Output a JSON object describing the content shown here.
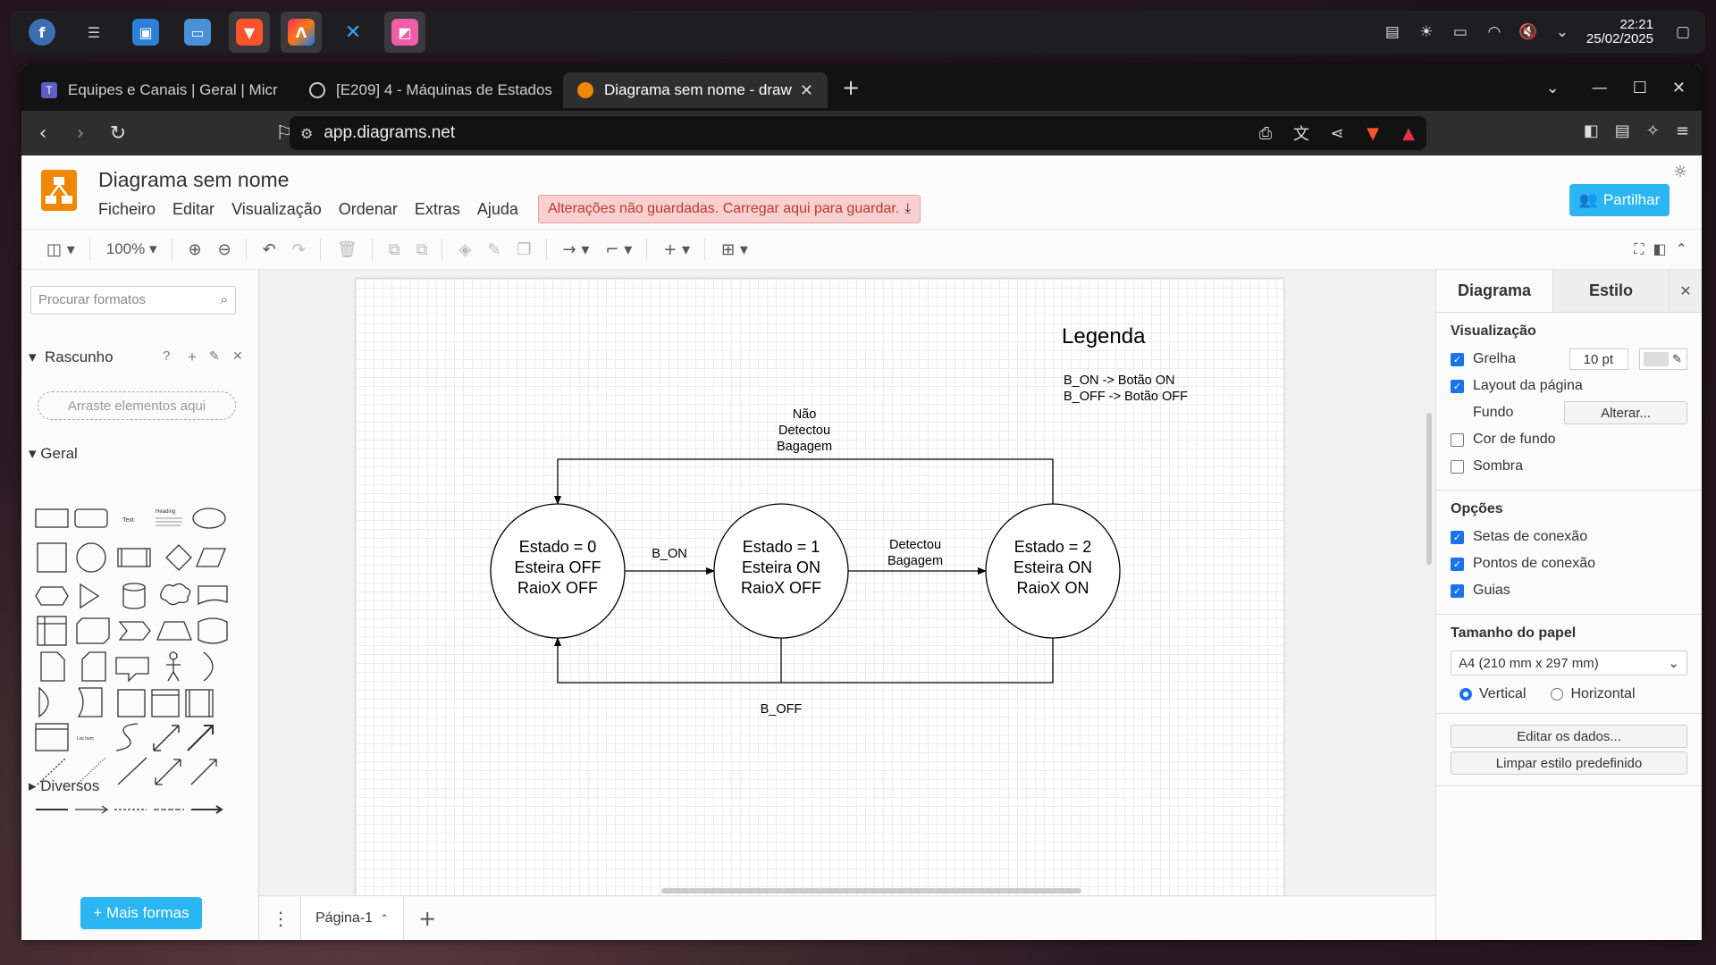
{
  "taskbar": {
    "apps": [
      "fedora-icon",
      "settings-app-icon",
      "software-store-icon",
      "file-manager-icon",
      "brave-browser-icon",
      "intellij-icon",
      "vscode-icon",
      "screenshot-app-icon"
    ],
    "clock_time": "22:21",
    "clock_date": "25/02/2025"
  },
  "browser": {
    "tabs": [
      {
        "label": "Equipes e Canais | Geral | Micr"
      },
      {
        "label": "[E209] 4 - Máquinas de Estados"
      },
      {
        "label": "Diagrama sem nome - draw"
      }
    ],
    "url": "app.diagrams.net"
  },
  "app": {
    "title": "Diagrama sem nome",
    "menu": [
      "Ficheiro",
      "Editar",
      "Visualização",
      "Ordenar",
      "Extras",
      "Ajuda"
    ],
    "unsaved_notice": "Alterações não guardadas. Carregar aqui para guardar.",
    "share_label": "Partilhar",
    "zoom": "100%"
  },
  "left_panel": {
    "search_placeholder": "Procurar formatos",
    "scratchpad_title": "Rascunho",
    "scratchpad_drop": "Arraste elementos aqui",
    "general_title": "Geral",
    "misc_title": "Diversos",
    "more_shapes": "+ Mais formas"
  },
  "diagram": {
    "legend_title": "Legenda",
    "legend_line1": "B_ON -> Botão ON",
    "legend_line2": "B_OFF -> Botão OFF",
    "states": [
      {
        "line1": "Estado = 0",
        "line2": "Esteira OFF",
        "line3": "RaioX OFF"
      },
      {
        "line1": "Estado = 1",
        "line2": "Esteira ON",
        "line3": "RaioX OFF"
      },
      {
        "line1": "Estado = 2",
        "line2": "Esteira ON",
        "line3": "RaioX ON"
      }
    ],
    "edge_b_on": "B_ON",
    "edge_detect_1": "Detectou",
    "edge_detect_2": "Bagagem",
    "edge_nodetect_1": "Não",
    "edge_nodetect_2": "Detectou",
    "edge_nodetect_3": "Bagagem",
    "edge_b_off": "B_OFF"
  },
  "page_tabs": {
    "current": "Página-1"
  },
  "right_panel": {
    "tab_diagram": "Diagrama",
    "tab_style": "Estilo",
    "view_title": "Visualização",
    "grid_label": "Grelha",
    "grid_size": "10 pt",
    "page_layout_label": "Layout da página",
    "background_label": "Fundo",
    "change_button": "Alterar...",
    "bg_color_label": "Cor de fundo",
    "shadow_label": "Sombra",
    "options_title": "Opções",
    "connection_arrows": "Setas de conexão",
    "connection_points": "Pontos de conexão",
    "guides": "Guias",
    "paper_size_title": "Tamanho do papel",
    "paper_size_value": "A4 (210 mm x 297 mm)",
    "portrait": "Vertical",
    "landscape": "Horizontal",
    "edit_data": "Editar os dados...",
    "clear_style": "Limpar estilo predefinido",
    "checks": {
      "grid": true,
      "page_layout": true,
      "bg_color": false,
      "shadow": false,
      "arrows": true,
      "points": true,
      "guides": true
    }
  },
  "colors": {
    "accent": "#29b6f2",
    "drawio_orange": "#f08705",
    "unsaved_bg": "#f8d0d0",
    "unsaved_text": "#c0392b"
  }
}
